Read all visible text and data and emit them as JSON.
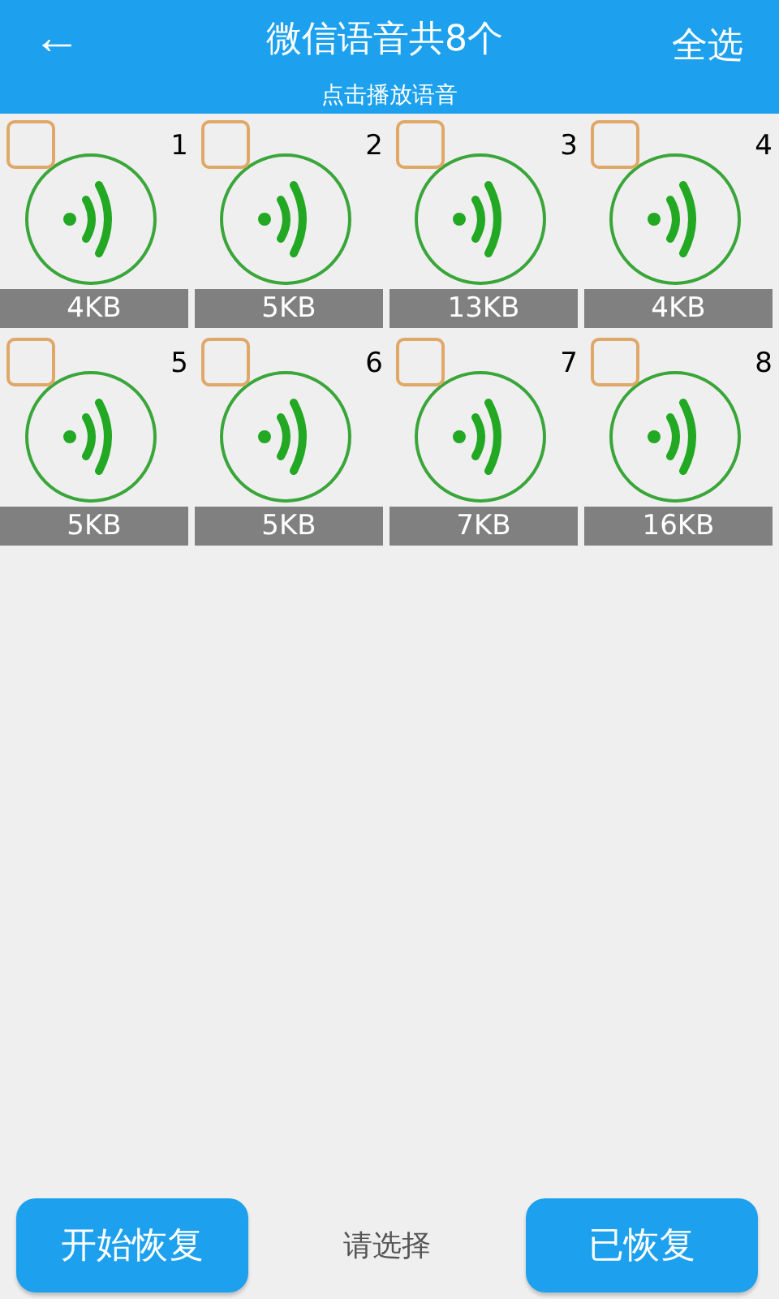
{
  "header": {
    "back": "←",
    "title": "微信语音共8个",
    "subtitle": "点击播放语音",
    "select_all": "全选"
  },
  "voices": [
    {
      "index": "1",
      "size": "4KB",
      "checked": false
    },
    {
      "index": "2",
      "size": "5KB",
      "checked": false
    },
    {
      "index": "3",
      "size": "13KB",
      "checked": false
    },
    {
      "index": "4",
      "size": "4KB",
      "checked": false
    },
    {
      "index": "5",
      "size": "5KB",
      "checked": false
    },
    {
      "index": "6",
      "size": "5KB",
      "checked": false
    },
    {
      "index": "7",
      "size": "7KB",
      "checked": false
    },
    {
      "index": "8",
      "size": "16KB",
      "checked": false
    }
  ],
  "footer": {
    "start_button": "开始恢复",
    "hint": "请选择",
    "restored_button": "已恢复"
  }
}
